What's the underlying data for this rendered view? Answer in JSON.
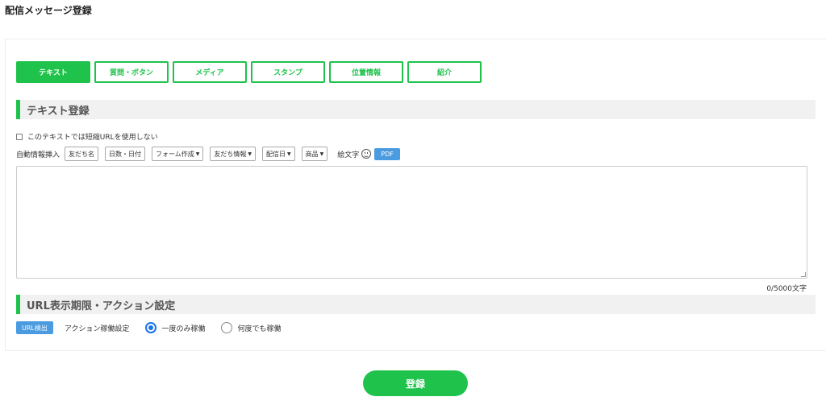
{
  "page": {
    "title": "配信メッセージ登録"
  },
  "tabs": [
    {
      "label": "テキスト",
      "active": true
    },
    {
      "label": "質問・ボタン"
    },
    {
      "label": "メディア"
    },
    {
      "label": "スタンプ"
    },
    {
      "label": "位置情報"
    },
    {
      "label": "紹介"
    }
  ],
  "text_section": {
    "title": "テキスト登録",
    "no_short_url_label": "このテキストでは短縮URLを使用しない",
    "auto_insert_label": "自動情報挿入",
    "insert_buttons": [
      {
        "label": "友だち名"
      },
      {
        "label": "日数・日付"
      },
      {
        "label": "フォーム作成"
      },
      {
        "label": "友だち情報"
      },
      {
        "label": "配信日"
      },
      {
        "label": "商品"
      }
    ],
    "emoji_label": "絵文字",
    "pdf_label": "PDF",
    "textarea_value": "",
    "char_count": "0/5000文字"
  },
  "url_section": {
    "title": "URL表示期限・アクション設定",
    "url_check_label": "URL検出",
    "action_label": "アクション稼働設定",
    "radio_once": "一度のみ稼働",
    "radio_many": "何度でも稼働",
    "selected": "once"
  },
  "submit_label": "登録",
  "colors": {
    "accent": "#1fc34b",
    "blue": "#4a9be0"
  }
}
